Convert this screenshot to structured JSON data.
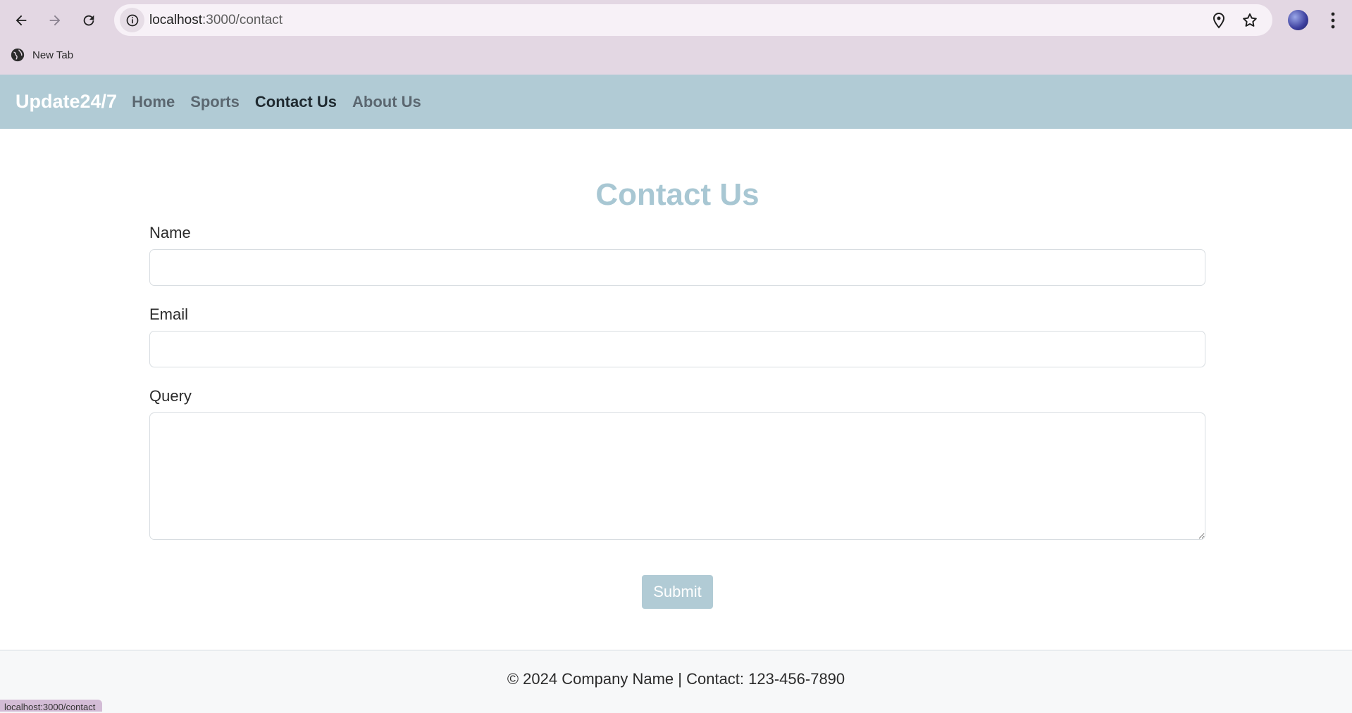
{
  "browser": {
    "url_host": "localhost",
    "url_path": ":3000/contact",
    "bookmark_label": "New Tab",
    "status_url": "localhost:3000/contact",
    "icons": [
      "back-icon",
      "forward-icon",
      "reload-icon",
      "site-info-icon",
      "location-icon",
      "star-icon",
      "profile-avatar",
      "menu-icon",
      "globe-icon"
    ]
  },
  "navbar": {
    "brand": "Update24/7",
    "links": [
      {
        "label": "Home",
        "active": false
      },
      {
        "label": "Sports",
        "active": false
      },
      {
        "label": "Contact Us",
        "active": true
      },
      {
        "label": "About Us",
        "active": false
      }
    ]
  },
  "form": {
    "title": "Contact Us",
    "name_label": "Name",
    "name_value": "",
    "email_label": "Email",
    "email_value": "",
    "query_label": "Query",
    "query_value": "",
    "submit_label": "Submit"
  },
  "footer": {
    "text": "© 2024 Company Name | Contact: 123-456-7890"
  },
  "colors": {
    "chrome_bg": "#e3d7e3",
    "navbar_bg": "#b1cbd5",
    "title_color": "#a8c7d3",
    "button_bg": "#b1cbd5"
  }
}
